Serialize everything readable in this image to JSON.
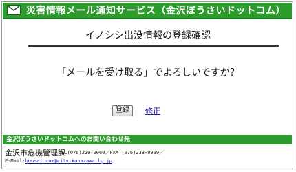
{
  "header": {
    "title": "災害情報メール通知サービス（金沢ぼうさいドットコム）",
    "icon": "mail-icon",
    "bar_color": "#2e9b2e"
  },
  "main": {
    "page_title": "イノシシ出没情報の登録確認",
    "question": "「メールを受け取る」でよろしいですか？",
    "register_label": "登録",
    "edit_label": "修正"
  },
  "footer": {
    "heading": "金沢ぼうさいドットコムへのお問い合わせ先",
    "org_name": "金沢市危機管理課",
    "phone_fax": "TEL(076)220-2060／FAX (076)233-9999／",
    "email_prefix": "E-Mail:",
    "email": "bousai.com@city.kanazawa.lg.jp"
  }
}
